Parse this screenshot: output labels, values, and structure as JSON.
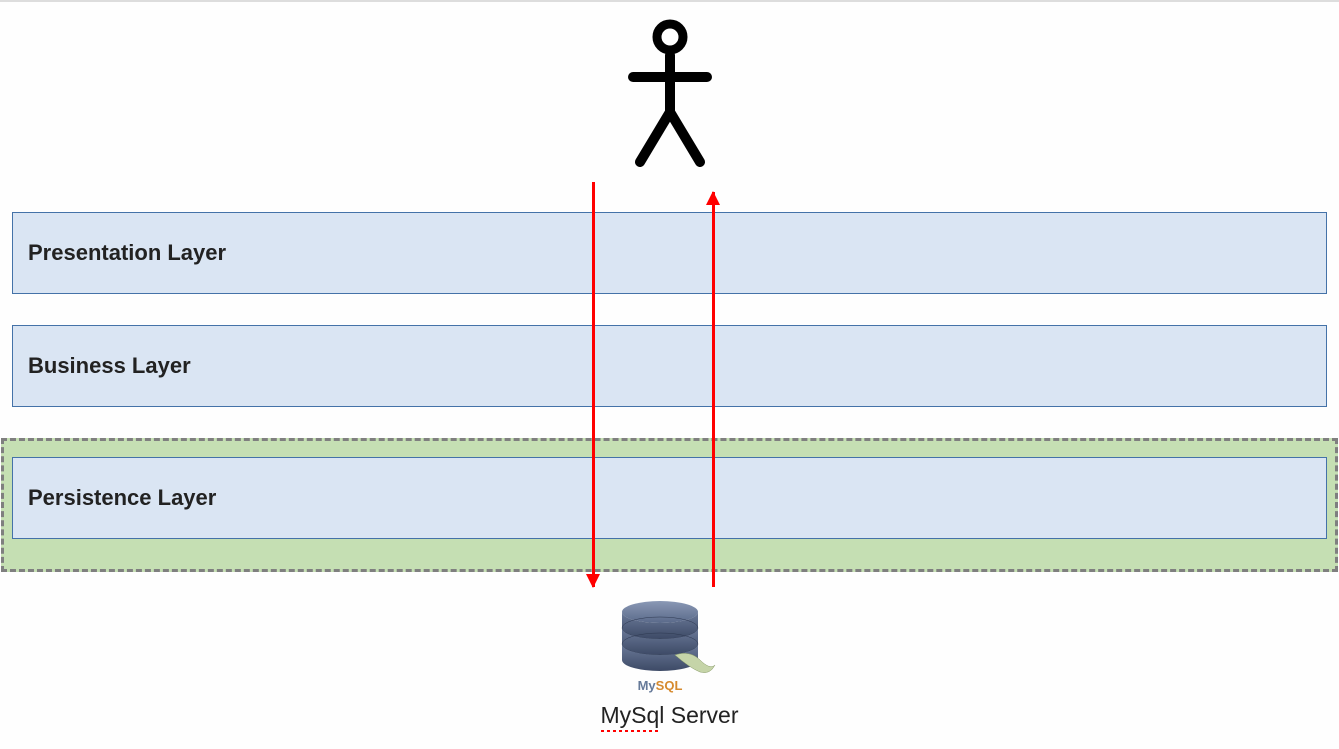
{
  "actor": {
    "name": "user-actor"
  },
  "layers": {
    "presentation": "Presentation Layer",
    "business": "Business Layer",
    "persistence": "Persistence Layer"
  },
  "database": {
    "label": "MySql Server",
    "logo_text": "MySQL"
  },
  "arrows": {
    "request": "downward-request-flow",
    "response": "upward-response-flow"
  },
  "colors": {
    "layer_fill": "#dae5f3",
    "layer_border": "#4472a8",
    "highlight_fill": "#c5dfb3",
    "dashed_border": "#7f7f7f",
    "arrow": "#ff0000"
  }
}
